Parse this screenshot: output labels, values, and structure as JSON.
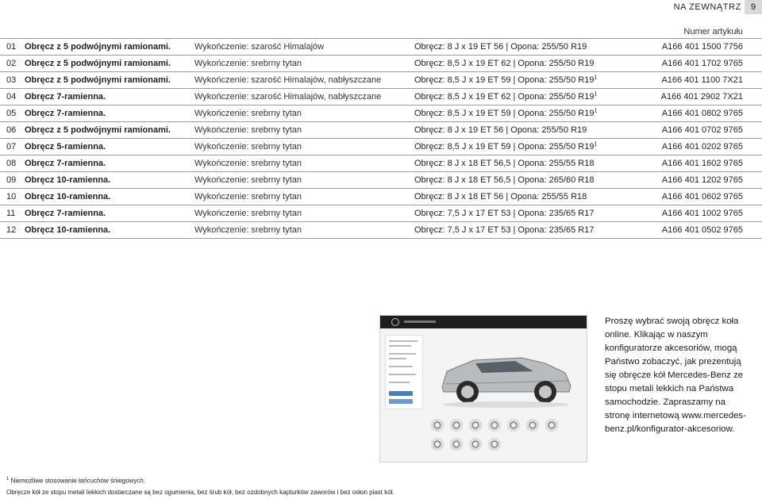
{
  "header": {
    "section_title": "NA ZEWNĄTRZ",
    "page_number": "9"
  },
  "table": {
    "part_column_header": "Numer artykułu",
    "rows": [
      {
        "num": "01",
        "name": "Obręcz z 5 podwójnymi ramionami.",
        "finish": "Wykończenie: szarość Himalajów",
        "rim": "Obręcz: 8 J x 19 ET 56 | Opona: 255/50 R19",
        "footnote": "",
        "part": "A166 401 1500 7756"
      },
      {
        "num": "02",
        "name": "Obręcz z 5 podwójnymi ramionami.",
        "finish": "Wykończenie: srebrny tytan",
        "rim": "Obręcz: 8,5 J x 19 ET 62 | Opona: 255/50 R19",
        "footnote": "",
        "part": "A166 401 1702 9765"
      },
      {
        "num": "03",
        "name": "Obręcz z 5 podwójnymi ramionami.",
        "finish": "Wykończenie: szarość Himalajów, nabłyszczane",
        "rim": "Obręcz: 8,5 J x 19 ET 59 | Opona: 255/50 R19",
        "footnote": "1",
        "part": "A166 401 1100 7X21"
      },
      {
        "num": "04",
        "name": "Obręcz 7-ramienna.",
        "finish": "Wykończenie: szarość Himalajów, nabłyszczane",
        "rim": "Obręcz: 8,5 J x 19 ET 62 | Opona: 255/50 R19",
        "footnote": "1",
        "part": "A166 401 2902 7X21"
      },
      {
        "num": "05",
        "name": "Obręcz 7-ramienna.",
        "finish": "Wykończenie: srebrny tytan",
        "rim": "Obręcz: 8,5 J x 19 ET 59 | Opona: 255/50 R19",
        "footnote": "1",
        "part": "A166 401 0802 9765"
      },
      {
        "num": "06",
        "name": "Obręcz z 5 podwójnymi ramionami.",
        "finish": "Wykończenie: srebrny tytan",
        "rim": "Obręcz: 8 J x 19 ET 56 | Opona: 255/50 R19",
        "footnote": "",
        "part": "A166 401 0702 9765"
      },
      {
        "num": "07",
        "name": "Obręcz 5-ramienna.",
        "finish": "Wykończenie: srebrny tytan",
        "rim": "Obręcz: 8,5 J x 19 ET 59 | Opona: 255/50 R19",
        "footnote": "1",
        "part": "A166 401 0202 9765"
      },
      {
        "num": "08",
        "name": "Obręcz 7-ramienna.",
        "finish": "Wykończenie: srebrny tytan",
        "rim": "Obręcz: 8 J x 18 ET 56,5 | Opona: 255/55 R18",
        "footnote": "",
        "part": "A166 401 1602 9765"
      },
      {
        "num": "09",
        "name": "Obręcz 10-ramienna.",
        "finish": "Wykończenie: srebrny tytan",
        "rim": "Obręcz: 8 J x 18 ET 56,5 | Opona: 265/60 R18",
        "footnote": "",
        "part": "A166 401 1202 9765"
      },
      {
        "num": "10",
        "name": "Obręcz 10-ramienna.",
        "finish": "Wykończenie: srebrny tytan",
        "rim": "Obręcz: 8 J x 18 ET 56 | Opona: 255/55 R18",
        "footnote": "",
        "part": "A166 401 0602 9765"
      },
      {
        "num": "11",
        "name": "Obręcz 7-ramienna.",
        "finish": "Wykończenie: srebrny tytan",
        "rim": "Obręcz: 7,5 J x 17 ET 53 | Opona: 235/65 R17",
        "footnote": "",
        "part": "A166 401 1002 9765"
      },
      {
        "num": "12",
        "name": "Obręcz 10-ramienna.",
        "finish": "Wykończenie: srebrny tytan",
        "rim": "Obręcz: 7,5 J x 17 ET 53 | Opona: 235/65 R17",
        "footnote": "",
        "part": "A166 401 0502 9765"
      }
    ]
  },
  "promo": {
    "text": "Proszę wybrać swoją obręcz koła online. Klikając w naszym konfiguratorze akcesoriów, mogą Państwo zobaczyć, jak prezentują się obręcze kół Mercedes-Benz ze stopu metali lekkich na Państwa samochodzie. Zapraszamy na stronę internetową www.mercedes-benz.pl/konfigurator-akcesoriow."
  },
  "footnotes": {
    "note1_mark": "1",
    "note1_text": "Niemożliwe stosowanie łańcuchów śniegowych.",
    "note2_text": "Obręcze kół ze stopu metali lekkich dostarczane są bez ogumienia, bez śrub kół, bez ozdobnych kapturków zaworów i bez osłon piast kół."
  },
  "colors": {
    "rule": "#9a9a9a",
    "page_box": "#d9d9d9"
  }
}
